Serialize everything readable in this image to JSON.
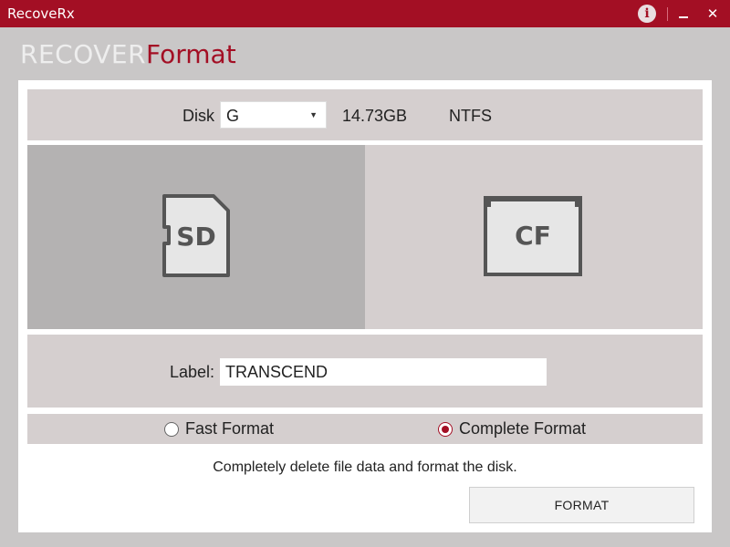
{
  "window": {
    "title": "RecoveRx",
    "close_glyph": "✕",
    "info_glyph": "i"
  },
  "tabs": {
    "recover": "RECOVER",
    "format": "Format",
    "active": "Format"
  },
  "disk": {
    "label": "Disk",
    "selected": "G",
    "size": "14.73GB",
    "filesystem": "NTFS"
  },
  "cards": {
    "selected": "SD",
    "sd_label": "SD",
    "cf_label": "CF"
  },
  "volume_label": {
    "label": "Label:",
    "value": "TRANSCEND"
  },
  "format_mode": {
    "fast_label": "Fast Format",
    "complete_label": "Complete Format",
    "selected": "Complete Format"
  },
  "description": "Completely delete file data and format the disk.",
  "format_button": "FORMAT",
  "colors": {
    "brand": "#a30f24",
    "background": "#c9c7c7",
    "row_bg": "#d5cfcf",
    "selected_card": "#b4b2b2"
  }
}
